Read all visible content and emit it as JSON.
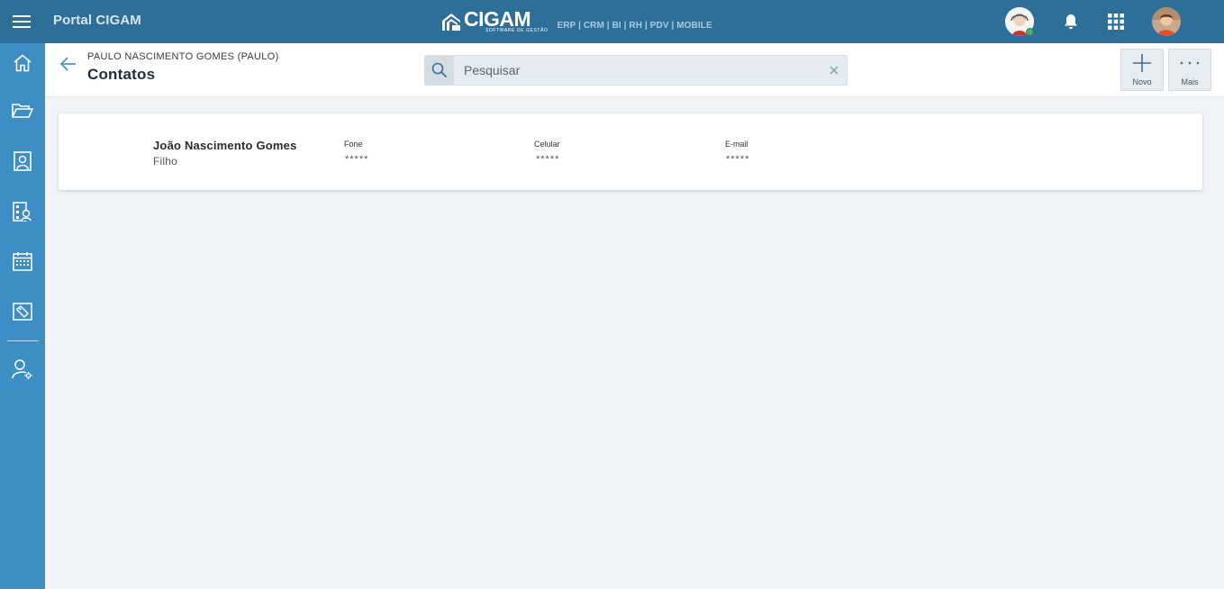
{
  "app": {
    "title": "Portal CIGAM",
    "brand_name": "CIGAM",
    "brand_tagline": "SOFTWARE DE GESTÃO",
    "brand_products": "ERP | CRM | BI | RH | PDV | MOBILE"
  },
  "sidebar": {
    "items": [
      {
        "icon": "home-icon"
      },
      {
        "icon": "folder-open-icon"
      },
      {
        "icon": "contacts-book-icon"
      },
      {
        "icon": "people-search-icon"
      },
      {
        "icon": "calendar-icon"
      },
      {
        "icon": "tag-card-icon"
      },
      {
        "icon": "user-settings-icon"
      }
    ]
  },
  "header": {
    "breadcrumb": "PAULO NASCIMENTO GOMES (PAULO)",
    "title": "Contatos"
  },
  "search": {
    "placeholder": "Pesquisar"
  },
  "actions": {
    "novo": "Novo",
    "mais": "Mais"
  },
  "contacts": [
    {
      "name": "João Nascimento Gomes",
      "relation": "Filho",
      "fone_label": "Fone",
      "fone": "*****",
      "celular_label": "Celular",
      "celular": "*****",
      "email_label": "E-mail",
      "email": "*****"
    }
  ],
  "colors": {
    "topbar": "#2d6f99",
    "sidebar": "#3d8ec4",
    "background": "#f0f3f7",
    "online_status": "#4caf50"
  }
}
